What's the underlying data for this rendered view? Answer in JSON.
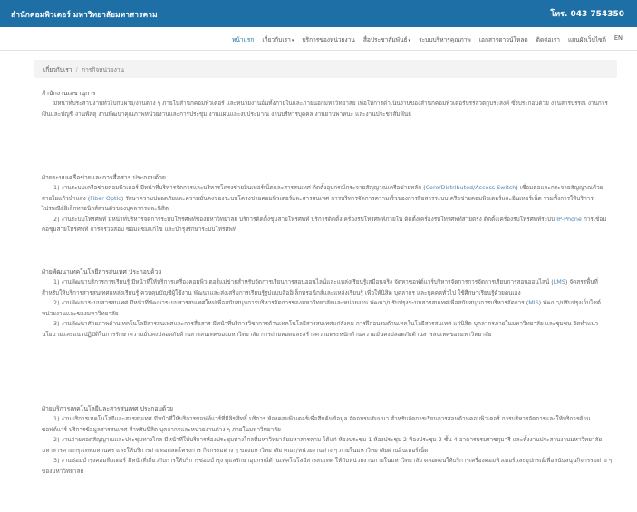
{
  "header": {
    "site_title": "สำนักคอมพิวเตอร์ มหาวิทยาลัยมหาสารคาม",
    "phone": "โทร. 043 754350"
  },
  "nav": {
    "items": [
      {
        "label": "หน้าแรก",
        "active": true,
        "dropdown": false
      },
      {
        "label": "เกี่ยวกับเรา",
        "active": false,
        "dropdown": true
      },
      {
        "label": "บริการของหน่วยงาน",
        "active": false,
        "dropdown": false
      },
      {
        "label": "สื่อประชาสัมพันธ์",
        "active": false,
        "dropdown": true
      },
      {
        "label": "ระบบบริหารคุณภาพ",
        "active": false,
        "dropdown": false
      },
      {
        "label": "เอกสารดาวน์โหลด",
        "active": false,
        "dropdown": false
      },
      {
        "label": "ติดต่อเรา",
        "active": false,
        "dropdown": false
      },
      {
        "label": "แผนผังเว็บไซต์",
        "active": false,
        "dropdown": false
      },
      {
        "label": "EN",
        "active": false,
        "dropdown": false
      }
    ]
  },
  "breadcrumb": {
    "parent": "เกี่ยวกับเรา",
    "separator": "/",
    "current": "ภารกิจหน่วยงาน"
  },
  "sections": {
    "s1": {
      "title": "สำนักงานเลขานุการ",
      "p1": "มีหน้าที่ประสานงานทั่วไปกับฝ่าย/งานต่าง ๆ ภายในสำนักคอมพิวเตอร์ และหน่วยงานอื่นทั้งภายในและภายนอกมหาวิทยาลัย เพื่อให้การดำเนินงานของสำนักคอมพิวเตอร์บรรลุวัตถุประสงค์ ซึ่งประกอบด้วย งานสารบรรณ งานการเงินและบัญชี งานพัสดุ งานพัฒนาคุณภาพหน่วยงานและการประชุม งานแผนและงบประมาณ งานบริหารบุคคล งานยานพาหนะ และงานประชาสัมพันธ์"
    },
    "s2": {
      "title": "ฝ่ายระบบเครือข่ายและการสื่อสาร ประกอบด้วย",
      "p1_a": "1) งานระบบเครือข่ายคอมพิวเตอร์ มีหน้าที่บริหารจัดการและบริหารโครงข่ายอินเทอร์เน็ตและสารสนเทศ ติดตั้งอุปกรณ์กระจายสัญญาณเครือข่ายหลัก (",
      "p1_hl": "Core/Distributed/Access Switch",
      "p1_b": ") เชื่อมต่อและกระจายสัญญาณด้วยสายใยแก้วนำแสง (",
      "p1_hl2": "Fiber Optic",
      "p1_c": ") รักษาความปลอดภัยและความมั่นคงของระบบโครงข่ายคอมพิวเตอร์และสารสนเทศ การบริหารจัดการความเร็วของการสื่อสารระบบเครือข่ายคอมพิวเตอร์และอินเทอร์เน็ต รวมทั้งการให้บริการไปรษณีย์อิเล็กทรอนิกส์ส่วนตัวของบุคลากรและนิสิต",
      "p2_a": "2) งานระบบโทรศัพท์ มีหน้าที่บริหารจัดการระบบโทรศัพท์ของมหาวิทยาลัย บริการติดตั้งชุมสายโทรศัพท์ บริการติดตั้งเครื่องรับโทรศัพท์ภายใน ติดตั้งเครื่องรับโทรศัพท์สายตรง ติดตั้งเครื่องรับโทรศัพท์ระบบ ",
      "p2_hl": "IP-Phone",
      "p2_b": " การเชื่อมต่อชุมสายโทรศัพท์ การตรวจสอบ ซ่อมแซมแก้ไข และบำรุงรักษาระบบโทรศัพท์"
    },
    "s3": {
      "title": "ฝ่ายพัฒนาเทคโนโลยีสารสนเทศ ประกอบด้วย",
      "p1_a": "1) งานพัฒนาบริการการเรียนรู้ มีหน้าที่ให้บริการเครื่องคอมพิวเตอร์แม่ข่ายสำหรับจัดการเรียนการสอนออนไลน์และแหล่งเรียนรู้เสมือนจริง จัดหาซอฟต์แวร์บริหารจัดการการจัดการเรียนการสอนออนไลน์ (",
      "p1_hl": "LMS",
      "p1_b": ") จัดสรรพื้นที่สำหรับให้บริการสารสนเทศแหล่งเรียนรู้ ควบคุมบัญชีผู้ใช้งาน พัฒนาและส่งเสริมการเรียนรู้รูปแบบสื่ออิเล็กทรอนิกส์และแหล่งเรียนรู้ เพื่อให้นิสิต บุคลากร และบุคคลทั่วไป ใช้ศึกษาเรียนรู้ด้วยตนเอง",
      "p2_a": "2) งานพัฒนาระบบสารสนเทศ มีหน้าที่พัฒนาระบบสารสนเทศใหม่เพื่อสนับสนุนการบริหารจัดการของมหาวิทยาลัยและหน่วยงาน พัฒนา/ปรับปรุงระบบสารสนเทศเพื่อสนับสนุนการบริหารจัดการ (",
      "p2_hl": "MIS",
      "p2_b": ") พัฒนา/ปรับปรุงเว็บไซต์หน่วยงานและของมหาวิทยาลัย",
      "p3": "3) งานพัฒนาศักยภาพด้านเทคโนโลยีสารสนเทศและการสื่อสาร มีหน้าที่บริการวิชาการด้านเทคโนโลยีสารสนเทศแก่สังคม การฝึกอบรมด้านเทคโนโลยีสารสนเทศ แก่นิสิต บุคลากรภายในมหาวิทยาลัย และชุมชน จัดทำแนวนโยบายและแนวปฏิบัติในการรักษาความมั่นคงปลอดภัยด้านสารสนเทศของมหาวิทยาลัย การถ่ายทอดและสร้างความตระหนักด้านความมั่นคงปลอดภัยด้านสารสนเทศของมหาวิทยาลัย"
    },
    "s4": {
      "title": "ฝ่ายบริการเทคโนโลยีและสารสนเทศ ประกอบด้วย",
      "p1": "1) งานบริการเทคโนโลยีและสารสนเทศ มีหน้าที่ให้บริการซอฟท์แวร์ที่มีลิขสิทธิ์ บริการ ห้องคอมพิวเตอร์เพื่อสืบค้นข้อมูล จัดอบรมสัมมนา สำหรับจัดการเรียนการสอนด้านคอมพิวเตอร์ การบริหารจัดการและให้บริการด้านซอฟต์แวร์ บริการข้อมูลสารสนเทศ สำหรับนิสิต บุคลากรและหน่วยงานต่าง ๆ ภายในมหาวิทยาลัย",
      "p2": "2) งานถ่ายทอดสัญญาณและประชุมทางไกล มีหน้าที่ให้บริการห้องประชุมทางไกลที่มหาวิทยาลัยมหาสารคาม ได้แก่ ห้องประชุม 1 ห้องประชุม 2 ห้องประชุม 2 ชั้น 4 อาคารบรมราชกุมารี และทั้งงานประสานงานมหาวิทยาลัยมหาสารคามกรุงเทพมหานคร และให้บริการถ่ายทอดสดโครงการ กิจกรรมต่าง ๆ ของมหาวิทยาลัย คณะ/หน่วยงานต่าง ๆ ภายในมหาวิทยาลัยผ่านอินเทอร์เน็ต",
      "p3": "3) งานซ่อมบำรุงคอมพิวเตอร์ มีหน้าที่เกี่ยวกับการให้บริการซ่อมบำรุง ดูแลรักษาอุปกรณ์ด้านเทคโนโลยีสารสนเทศ ให้กับหน่วยงานภายในมหาวิทยาลัย ตลอดจนให้บริการเครื่องคอมพิวเตอร์และอุปกรณ์เพื่อสนับสนุนกิจกรรมต่าง ๆ ของมหาวิทยาลัย"
    }
  },
  "colors": {
    "header_bg": "#1d6fa6",
    "link_highlight": "#4a86b8"
  }
}
